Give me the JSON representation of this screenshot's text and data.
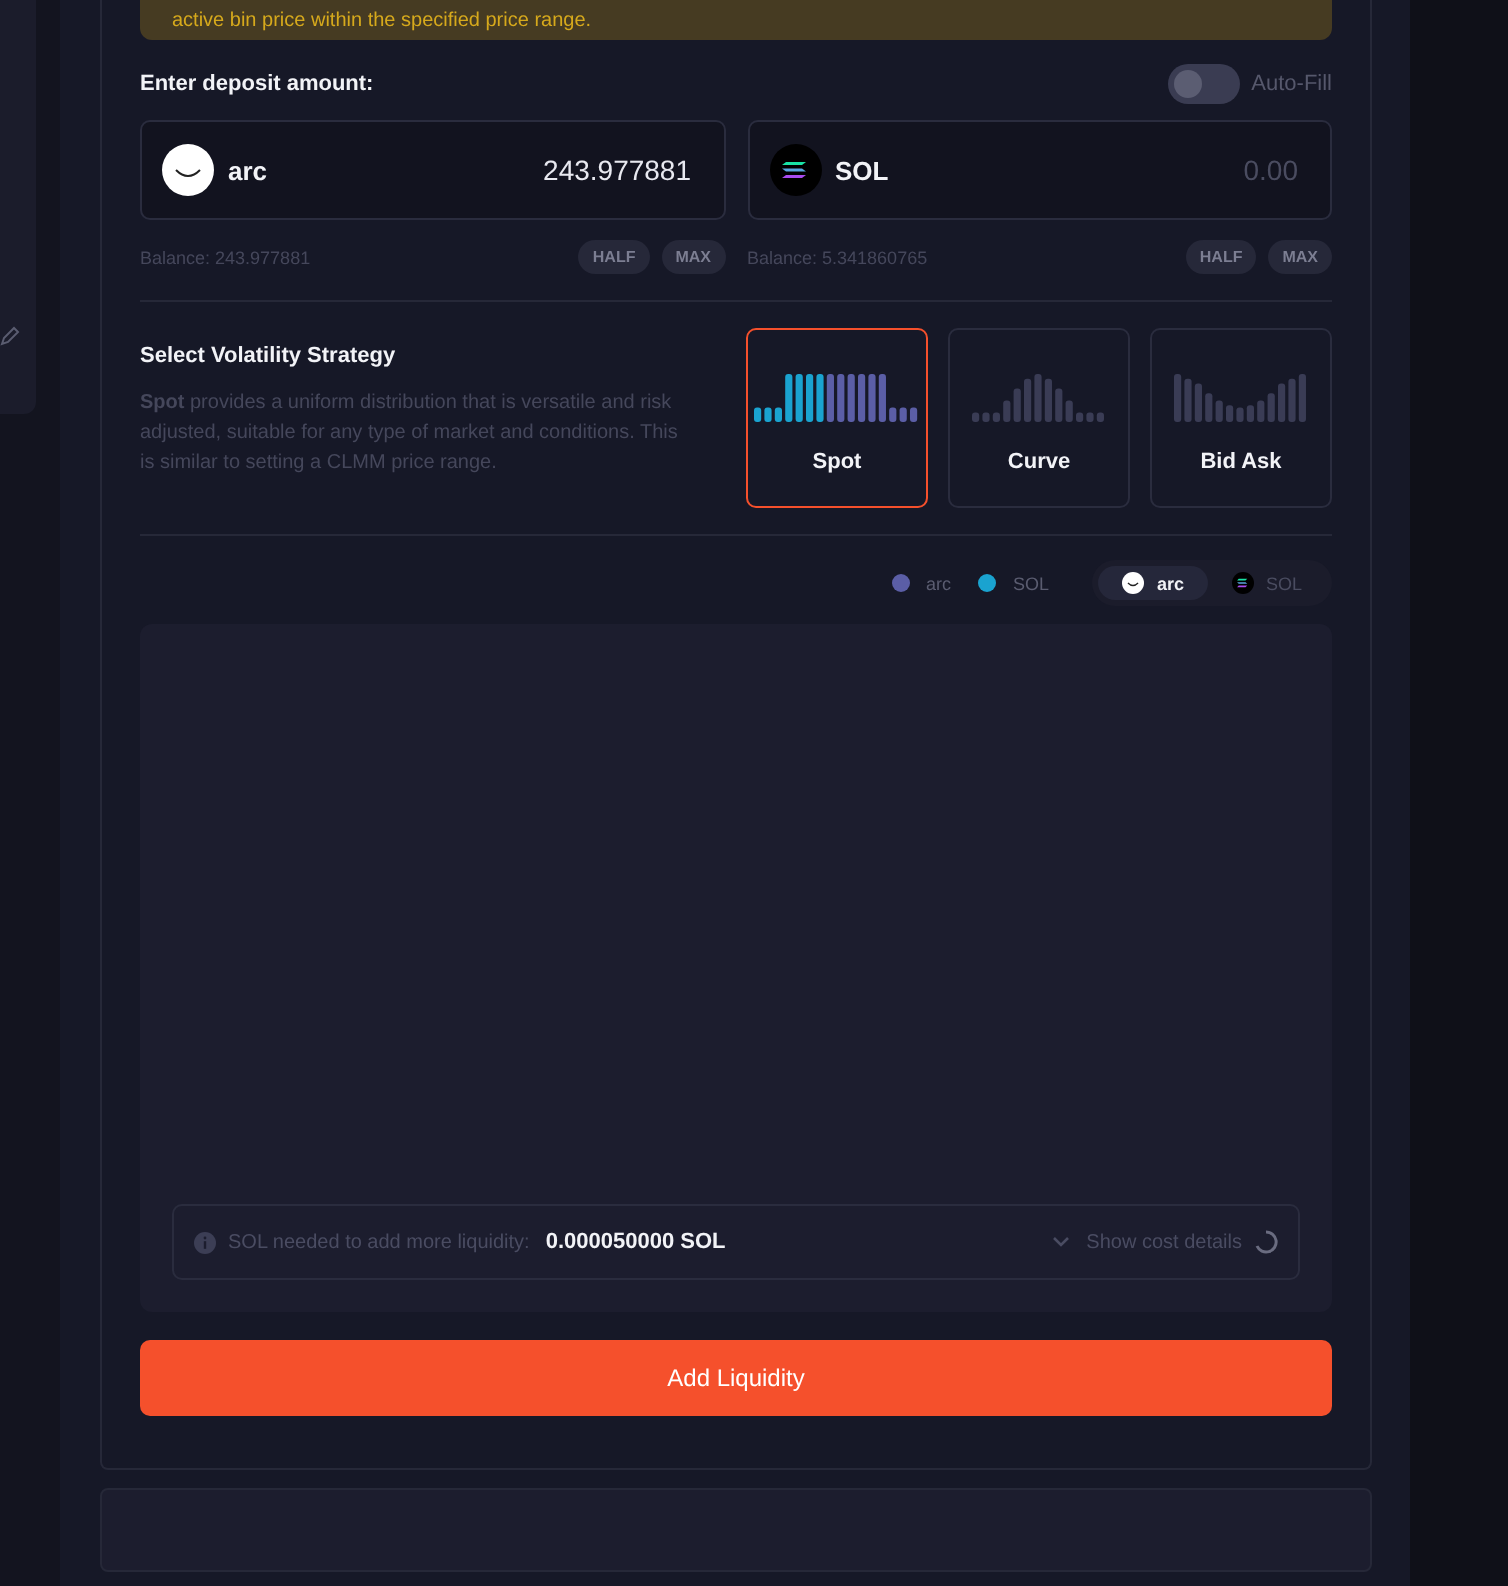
{
  "notice": {
    "text": "active bin price within the specified price range."
  },
  "deposit": {
    "label": "Enter deposit amount:",
    "auto_fill": {
      "label": "Auto-Fill",
      "on": false
    },
    "tokens": [
      {
        "kind": "arc",
        "symbol": "arc",
        "value": "243.977881",
        "balance": "Balance: 243.977881",
        "buttons": [
          "HALF",
          "MAX"
        ]
      },
      {
        "kind": "sol",
        "symbol": "SOL",
        "placeholder": "0.00",
        "balance": "Balance: 5.341860765",
        "buttons": [
          "HALF",
          "MAX"
        ]
      }
    ]
  },
  "strategy": {
    "title": "Select Volatility Strategy",
    "description": "**Spot** provides a uniform distribution that is versatile and risk adjusted, suitable for any type of market and conditions. This is similar to setting a CLMM price range.",
    "options": [
      {
        "kind": "spot",
        "label": "Spot",
        "selected": true
      },
      {
        "kind": "curve",
        "label": "Curve",
        "selected": false
      },
      {
        "kind": "bidask",
        "label": "Bid Ask",
        "selected": false
      }
    ]
  },
  "legend": [
    {
      "label": "arc",
      "color": "#5b5ea6"
    },
    {
      "label": "SOL",
      "color": "#1aa3d0"
    }
  ],
  "token_toggle": [
    {
      "kind": "arc",
      "label": "arc",
      "selected": true
    },
    {
      "kind": "sol",
      "label": "SOL",
      "selected": false
    }
  ],
  "cost": {
    "label": "SOL needed to add more liquidity:",
    "value": "0.000050000 SOL",
    "details": "Show cost details"
  },
  "submit": "Add Liquidity"
}
